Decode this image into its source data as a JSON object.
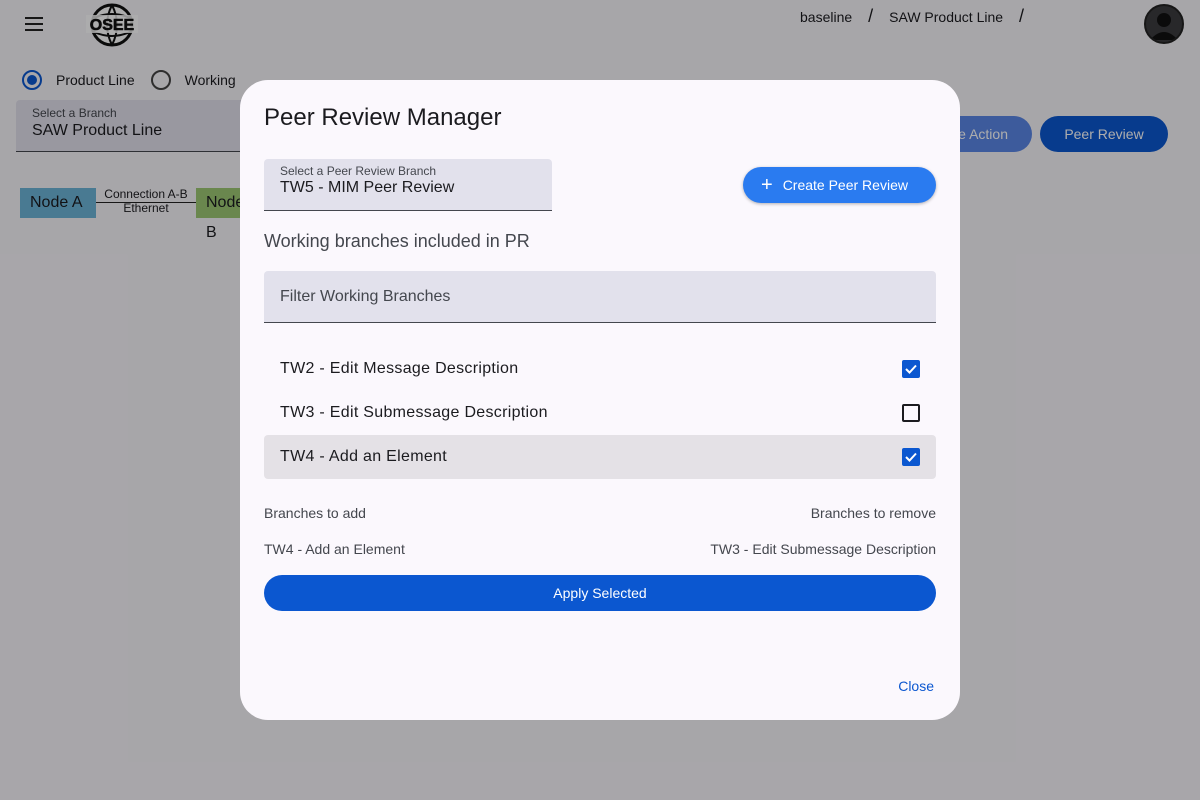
{
  "header": {
    "logo_text": "OSEE",
    "breadcrumb": [
      "baseline",
      "SAW Product Line"
    ],
    "breadcrumb_separator": "/"
  },
  "view_mode": {
    "options": [
      {
        "label": "Product Line",
        "checked": true
      },
      {
        "label": "Working",
        "checked": false
      }
    ]
  },
  "branch_select": {
    "label": "Select a Branch",
    "value": "SAW Product Line"
  },
  "graph": {
    "nodes": [
      "Node A",
      "Node B"
    ],
    "edge": {
      "line1": "Connection A-B",
      "line2": "Ethernet"
    }
  },
  "toolbar": {
    "action_label": "Create Action",
    "peer_review_label": "Peer Review"
  },
  "dialog": {
    "title": "Peer Review Manager",
    "pr_select": {
      "label": "Select a Peer Review Branch",
      "value": "TW5 - MIM Peer Review"
    },
    "create_button": "Create Peer Review",
    "section_heading": "Working branches included in PR",
    "filter_placeholder": "Filter Working Branches",
    "branches": [
      {
        "label": "TW2 - Edit Message Description",
        "checked": true
      },
      {
        "label": "TW3 - Edit Submessage Description",
        "checked": false
      },
      {
        "label": "TW4 - Add an Element",
        "checked": true
      }
    ],
    "to_add_heading": "Branches to add",
    "to_remove_heading": "Branches to remove",
    "to_add": "TW4 - Add an Element",
    "to_remove": "TW3 - Edit Submessage Description",
    "apply_button": "Apply Selected",
    "close_button": "Close"
  },
  "colors": {
    "primary": "#0b57d0",
    "create_button": "#2a7bf0",
    "dialog_bg": "#fbf8fd",
    "field_bg": "#e2e1ec"
  }
}
